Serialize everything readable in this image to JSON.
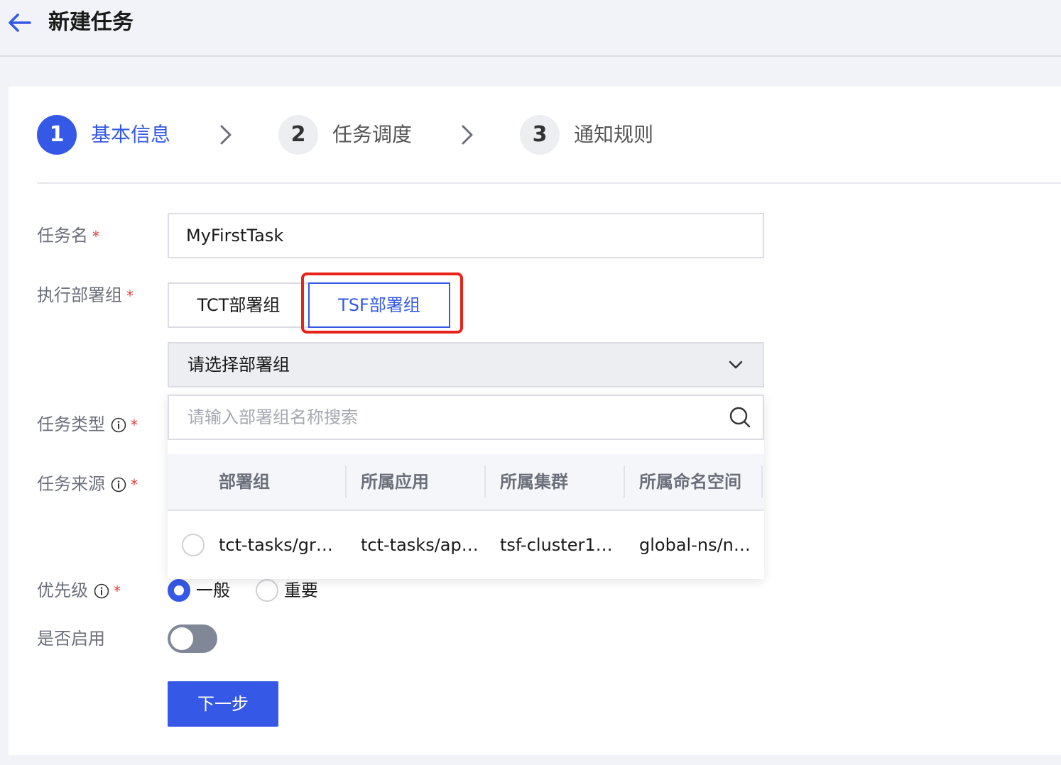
{
  "header": {
    "title": "新建任务"
  },
  "steps": [
    {
      "number": "1",
      "label": "基本信息"
    },
    {
      "number": "2",
      "label": "任务调度"
    },
    {
      "number": "3",
      "label": "通知规则"
    }
  ],
  "form": {
    "task_name": {
      "label": "任务名",
      "value": "MyFirstTask"
    },
    "deploy_group": {
      "label": "执行部署组",
      "options": [
        "TCT部署组",
        "TSF部署组"
      ],
      "selected": "TSF部署组",
      "select_placeholder": "请选择部署组"
    },
    "task_type": {
      "label": "任务类型"
    },
    "task_source": {
      "label": "任务来源"
    },
    "priority": {
      "label": "优先级",
      "options": [
        "一般",
        "重要"
      ],
      "selected": "一般"
    },
    "enabled": {
      "label": "是否启用",
      "value": false
    },
    "required_mark": "*",
    "next_label": "下一步"
  },
  "dropdown": {
    "search_placeholder": "请输入部署组名称搜索",
    "columns": [
      "部署组",
      "所属应用",
      "所属集群",
      "所属命名空间"
    ],
    "rows": [
      [
        "tct-tasks/gr…",
        "tct-tasks/ap…",
        "tsf-cluster1…",
        "global-ns/n…"
      ]
    ]
  },
  "colors": {
    "primary": "#3558e6",
    "highlight": "#e8241a",
    "required": "#e03c3c"
  }
}
